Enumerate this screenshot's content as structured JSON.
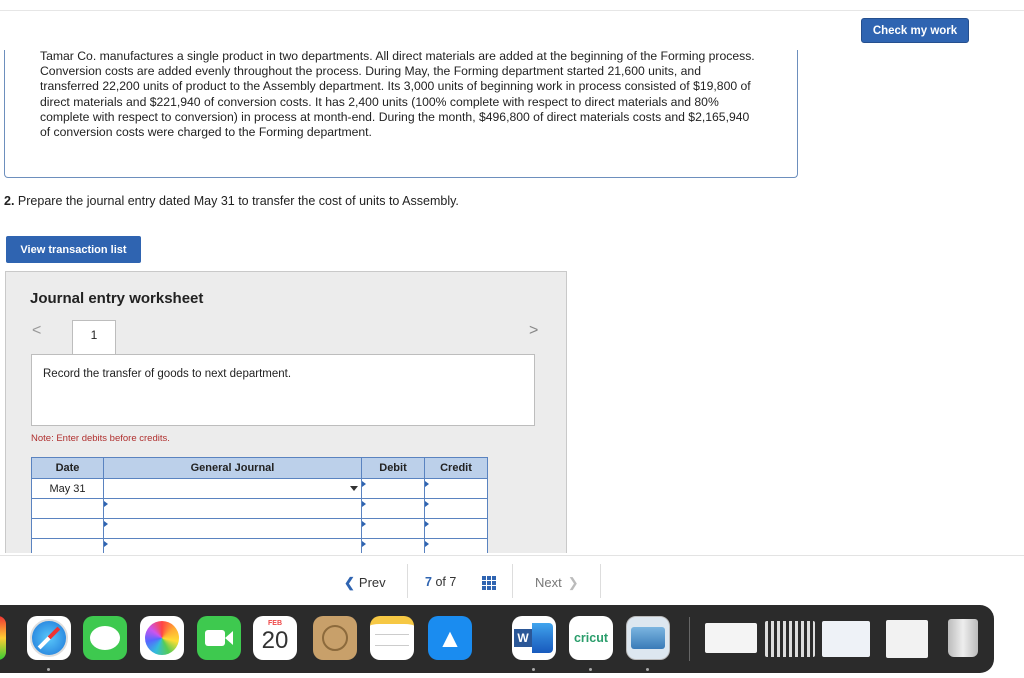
{
  "header": {
    "check_button": "Check my work"
  },
  "problem": {
    "text": "Tamar Co. manufactures a single product in two departments. All direct materials are added at the beginning of the Forming process. Conversion costs are added evenly throughout the process. During May, the Forming department started 21,600 units, and transferred 22,200 units of product to the Assembly department. Its 3,000 units of beginning work in process consisted of $19,800 of direct materials and $221,940 of conversion costs. It has 2,400 units (100% complete with respect to direct materials and 80% complete with respect to conversion) in process at month-end. During the month, $496,800 of direct materials costs and $2,165,940 of conversion costs were charged to the Forming department."
  },
  "question": {
    "number": "2.",
    "text": "Prepare the journal entry dated May 31 to transfer the cost of units to Assembly."
  },
  "view_transaction_button": "View transaction list",
  "worksheet": {
    "title": "Journal entry worksheet",
    "prev_arrow": "<",
    "next_arrow": ">",
    "tab_label": "1",
    "instruction": "Record the transfer of goods to next department.",
    "note": "Note: Enter debits before credits.",
    "columns": {
      "date": "Date",
      "general_journal": "General Journal",
      "debit": "Debit",
      "credit": "Credit"
    },
    "rows": [
      {
        "date": "May 31",
        "account": "",
        "debit": "",
        "credit": ""
      },
      {
        "date": "",
        "account": "",
        "debit": "",
        "credit": ""
      },
      {
        "date": "",
        "account": "",
        "debit": "",
        "credit": ""
      },
      {
        "date": "",
        "account": "",
        "debit": "",
        "credit": ""
      }
    ]
  },
  "pagination": {
    "prev": "Prev",
    "current": "7",
    "of_label": "of",
    "total": "7",
    "next": "Next"
  },
  "dock": {
    "calendar_month": "FEB",
    "calendar_day": "20",
    "word_letter": "W",
    "cricut_label": "cricut"
  },
  "colors": {
    "primary_blue": "#2f64b1",
    "table_header": "#bcd0ea",
    "note_red": "#b0302f"
  }
}
